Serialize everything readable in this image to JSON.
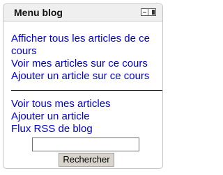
{
  "block": {
    "title": "Menu blog",
    "controls": {
      "hide_icon": "minus-box-icon",
      "dock_icon": "dock-sidebar-icon"
    }
  },
  "links_group_1": [
    {
      "label": "Afficher tous les articles de ce cours"
    },
    {
      "label": "Voir mes articles sur ce cours"
    },
    {
      "label": "Ajouter un article sur ce cours"
    }
  ],
  "links_group_2": [
    {
      "label": "Voir tous mes articles"
    },
    {
      "label": "Ajouter un article"
    },
    {
      "label": "Flux RSS de blog"
    }
  ],
  "search": {
    "value": "",
    "button_label": "Rechercher"
  },
  "colors": {
    "link": "#0000cc",
    "header_bg": "#efefef",
    "button_bg": "#d9d5cc"
  }
}
